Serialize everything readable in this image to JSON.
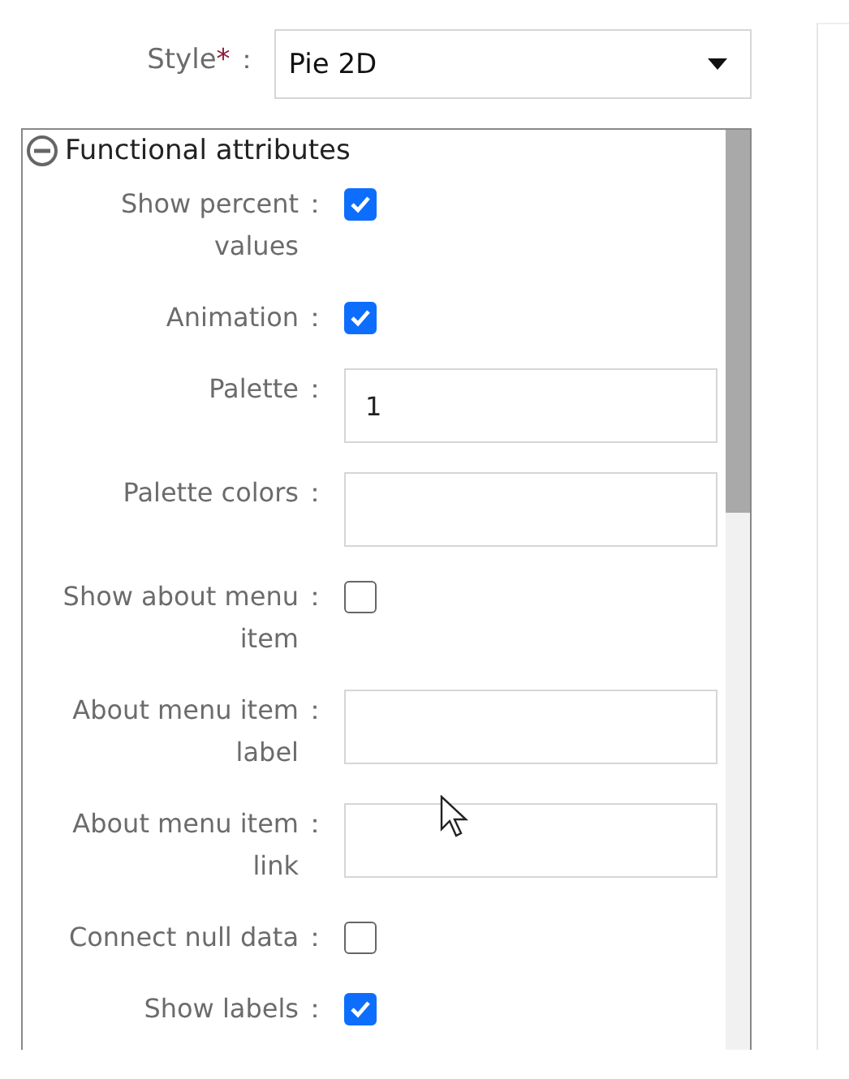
{
  "style_field": {
    "label": "Style",
    "required_mark": "*",
    "separator": "：",
    "value": "Pie 2D"
  },
  "panel": {
    "title": "Functional attributes",
    "expanded": true,
    "fields": [
      {
        "kind": "checkbox",
        "label": "Show percent values",
        "separator": "：",
        "checked": true
      },
      {
        "kind": "checkbox",
        "label": "Animation",
        "separator": "：",
        "checked": true
      },
      {
        "kind": "input",
        "label": "Palette",
        "separator": "：",
        "value": "1"
      },
      {
        "kind": "input",
        "label": "Palette colors",
        "separator": "："
      },
      {
        "kind": "checkbox",
        "label": "Show about menu item",
        "separator": "：",
        "checked": false
      },
      {
        "kind": "input",
        "label": "About menu item label",
        "separator": "："
      },
      {
        "kind": "input",
        "label": "About menu item link",
        "separator": "："
      },
      {
        "kind": "checkbox",
        "label": "Connect null data",
        "separator": "：",
        "checked": false
      },
      {
        "kind": "checkbox",
        "label": "Show labels",
        "separator": "：",
        "checked": true
      }
    ]
  }
}
